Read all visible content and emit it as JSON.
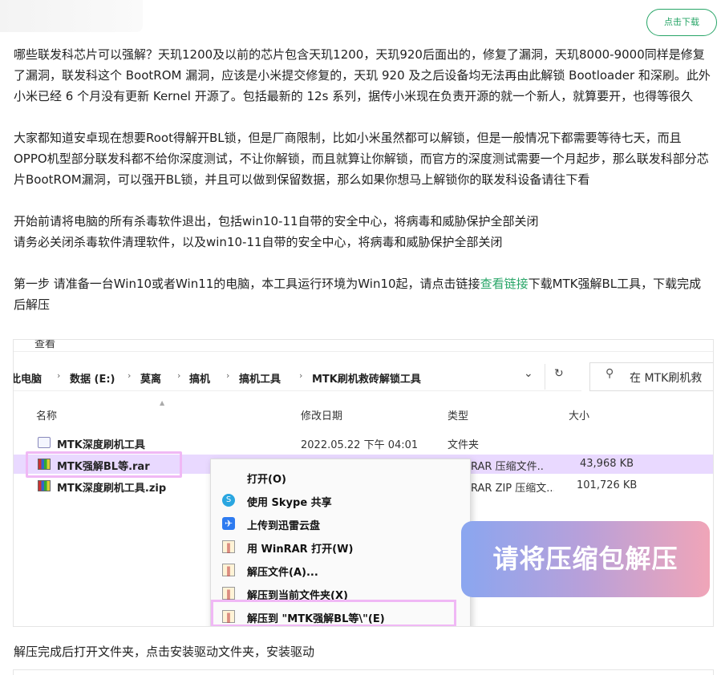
{
  "header": {
    "download_button": "点击下载"
  },
  "article": {
    "paragraphs": [
      "哪些联发科芯片可以强解？天玑1200及以前的芯片包含天玑1200，天玑920后面出的，修复了漏洞，天玑8000-9000同样是修复了漏洞，联发科这个 BootROM 漏洞，应该是小米提交修复的，天玑 920 及之后设备均无法再由此解锁 Bootloader 和深刷。此外小米已经 6 个月没有更新 Kernel 开源了。包括最新的 12s 系列，据传小米现在负责开源的就一个新人，就算要开，也得等很久",
      "大家都知道安卓现在想要Root得解开BL锁，但是厂商限制，比如小米虽然都可以解锁，但是一般情况下都需要等待七天，而且OPPO机型部分联发科都不给你深度测试，不让你解锁，而且就算让你解锁，而官方的深度测试需要一个月起步，那么联发科部分芯片BootROM漏洞，可以强开BL锁，并且可以做到保留数据，那么如果你想马上解锁你的联发科设备请往下看",
      "开始前请将电脑的所有杀毒软件退出，包括win10-11自带的安全中心，将病毒和威胁保护全部关闭",
      "请务必关闭杀毒软件清理软件，以及win10-11自带的安全中心，将病毒和威胁保护全部关闭"
    ],
    "step1_before": "第一步 请准备一台Win10或者Win11的电脑，本工具运行环境为Win10起，请点击链接",
    "step1_link": "查看链接",
    "step1_after": "下载MTK强解BL工具，下载完成后解压",
    "after_screenshot": "解压完成后打开文件夹，点击安装驱动文件夹，安装驱动"
  },
  "screenshot": {
    "menu_top": "查看",
    "breadcrumb": [
      "此电脑",
      "数据 (E:)",
      "莫离",
      "搞机",
      "搞机工具",
      "MTK刷机救砖解锁工具"
    ],
    "search_placeholder": "在 MTK刷机救",
    "columns": {
      "name": "名称",
      "modified": "修改日期",
      "type": "类型",
      "size": "大小"
    },
    "files": [
      {
        "name": "MTK深度刷机工具",
        "modified": "2022.05.22 下午 04:01",
        "type": "文件夹",
        "size": "",
        "icon": "folder-icon"
      },
      {
        "name": "MTK强解BL等.rar",
        "modified": "",
        "type": "RAR 压缩文件...",
        "size": "43,968 KB",
        "icon": "winrar-icon"
      },
      {
        "name": "MTK深度刷机工具.zip",
        "modified": "",
        "type": "RAR ZIP 压缩文...",
        "size": "101,726 KB",
        "icon": "winrar-icon"
      }
    ],
    "context_menu": [
      {
        "label": "打开(O)",
        "icon": ""
      },
      {
        "label": "使用 Skype 共享",
        "icon": "skype-icon"
      },
      {
        "label": "上传到迅雷云盘",
        "icon": "thunder-icon"
      },
      {
        "label": "用 WinRAR 打开(W)",
        "icon": "winrar-icon"
      },
      {
        "label": "解压文件(A)...",
        "icon": "winrar-icon"
      },
      {
        "label": "解压到当前文件夹(X)",
        "icon": "winrar-icon"
      },
      {
        "label": "解压到 \"MTK强解BL等\\\"(E)",
        "icon": "winrar-icon"
      }
    ],
    "banner": "请将压缩包解压",
    "colors": {
      "highlight": "#f0b8f5",
      "selected_row": "#e9d9ff",
      "accent": "#27a567"
    }
  }
}
